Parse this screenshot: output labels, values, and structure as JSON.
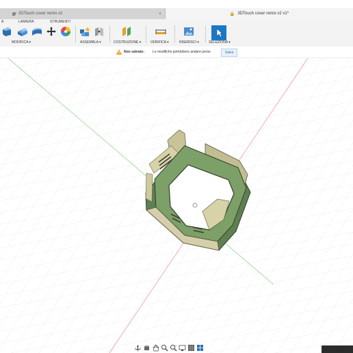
{
  "tabs": {
    "inactive_label": "3DTouch cover remix x2",
    "active_label": "3DTouch cover remix v2 v1*",
    "close_glyph": "×"
  },
  "toolbar": {
    "groups": {
      "partial_label": "A",
      "lamiera": "LAMIERA",
      "strumenti": "STRUMENTI",
      "modifica": "MODIFICA ▾",
      "assembla": "ASSEMBLA ▾",
      "costruzione": "COSTRUZIONE ▾",
      "verifica": "VERIFICA ▾",
      "inserisci": "INSERISCI ▾",
      "seleziona": "SELEZIONA ▾"
    },
    "colors": {
      "blue_accent": "#1a78c8",
      "green": "#4fa65a",
      "orange": "#e1a02a"
    }
  },
  "notice": {
    "status": "Non salvato:",
    "message": "Le modifiche potrebbero andare perse",
    "save_label": "Salva"
  },
  "viewport": {
    "background": "#ffffff",
    "grid_color": "#e2e2e2",
    "axis_green": "#7fcf7f",
    "axis_red": "#f08080",
    "model_color": "#6f8f5f"
  },
  "navbar": {
    "icons": [
      "orbit-icon",
      "look-at-icon",
      "pan-icon",
      "zoom-icon",
      "zoom-window-icon",
      "display-icon",
      "grid-icon",
      "viewports-icon"
    ]
  }
}
